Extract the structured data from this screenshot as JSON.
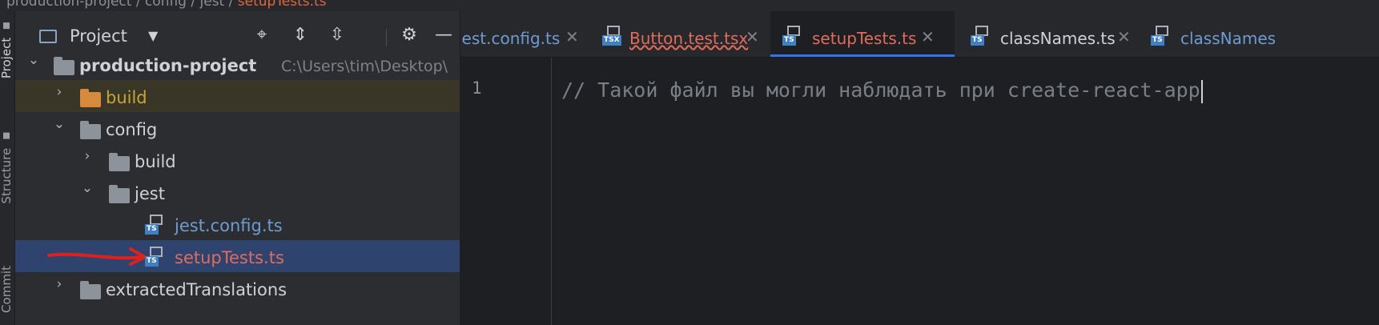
{
  "breadcrumb": {
    "before": "production-project / config / jest /",
    "file": "setupTests.ts"
  },
  "sidebar": {
    "tabs": [
      {
        "label": "Project",
        "icon": "folder-icon"
      },
      {
        "label": "Structure",
        "icon": "structure-icon"
      },
      {
        "label": "Commit",
        "icon": "commit-icon"
      }
    ]
  },
  "project_panel": {
    "title": "Project",
    "toolbar_icons": [
      "locate-icon",
      "expand-all-icon",
      "collapse-all-icon",
      "gear-icon",
      "hide-icon"
    ]
  },
  "tree": {
    "root": {
      "label": "production-project",
      "path": "C:\\Users\\tim\\Desktop\\"
    },
    "build": "build",
    "config": "config",
    "config_build": "build",
    "jest": "jest",
    "jest_config": "jest.config.ts",
    "setup_tests": "setupTests.ts",
    "extracted": "extractedTranslations"
  },
  "tabs": [
    {
      "label": "jest.config.ts",
      "badge": "TS"
    },
    {
      "label": "Button.test.tsx",
      "badge": "TSX"
    },
    {
      "label": "setupTests.ts",
      "badge": "TS"
    },
    {
      "label": "classNames.ts",
      "badge": "TS"
    },
    {
      "label": "classNames",
      "badge": "TS"
    }
  ],
  "editor": {
    "line_number": "1",
    "code": "// Такой файл вы могли наблюдать при create-react-app"
  },
  "colors": {
    "accent": "#3574f0",
    "selection": "#2e436e",
    "error": "#e06c5a",
    "ts_link": "#6e9bd1",
    "annotation_arrow": "#e0201b"
  }
}
